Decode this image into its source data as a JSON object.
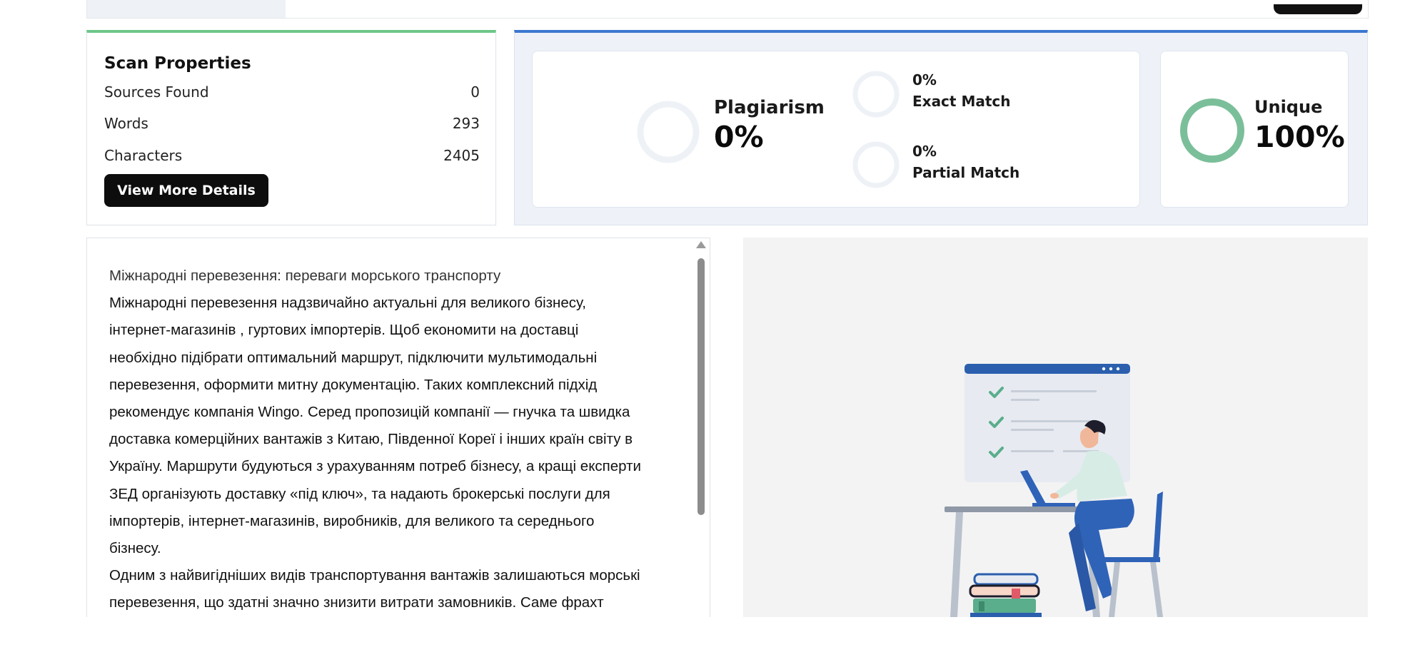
{
  "scan_properties": {
    "title": "Scan Properties",
    "rows": [
      {
        "label": "Sources Found",
        "value": "0"
      },
      {
        "label": "Words",
        "value": "293"
      },
      {
        "label": "Characters",
        "value": "2405"
      }
    ],
    "button_label": "View More Details"
  },
  "results": {
    "plagiarism": {
      "label": "Plagiarism",
      "value": "0%",
      "percent": 0
    },
    "exact_match": {
      "value": "0%",
      "label": "Exact Match",
      "percent": 0
    },
    "partial_match": {
      "value": "0%",
      "label": "Partial Match",
      "percent": 0
    },
    "unique": {
      "label": "Unique",
      "value": "100%",
      "percent": 100
    }
  },
  "colors": {
    "unique_ring": "#7bbf9a",
    "empty_ring": "#eef2f7",
    "scan_accent": "#6cc788",
    "results_accent": "#3a78d0"
  },
  "document": {
    "title_line": "Міжнародні перевезення: переваги морського транспорту",
    "lines": [
      "Міжнародні перевезення надзвичайно актуальні для великого бізнесу,",
      "інтернет-магазинів , гуртових імпортерів. Щоб економити на доставці",
      "необхідно підібрати оптимальний маршрут, підключити мультимодальні",
      "перевезення, оформити митну документацію. Таких комплексний підхід",
      "рекомендує компанія Wingo. Серед пропозицій компанії — гнучка та швидка",
      "доставка комерційних вантажів з Китаю, Південної Кореї і інших країн світу в",
      "Україну. Маршрути будуються з урахуванням потреб бізнесу, а кращі експерти",
      "ЗЕД організують доставку «під ключ», та надають брокерські послуги для",
      "імпортерів, інтернет-магазинів, виробників, для великого та середнього",
      "бізнесу.",
      "Одним з найвигідніших видів транспортування вантажів залишаються морські",
      "перевезення, що здатні значно знизити витрати замовників. Саме фрахт"
    ]
  }
}
